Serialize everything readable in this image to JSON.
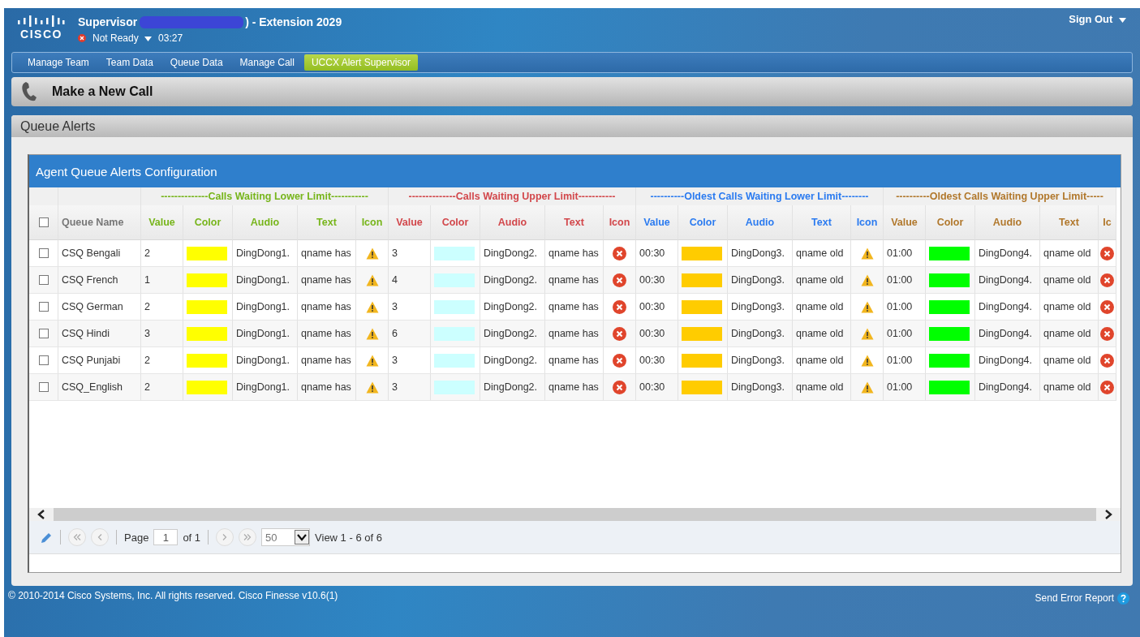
{
  "header": {
    "logo": "CISCO",
    "title_start": "Supervisor",
    "title_end": ") - Extension 2029",
    "status": "Not Ready",
    "timer": "03:27",
    "sign_out": "Sign Out"
  },
  "tabs": [
    {
      "label": "Manage Team",
      "selected": false
    },
    {
      "label": "Team Data",
      "selected": false
    },
    {
      "label": "Queue Data",
      "selected": false
    },
    {
      "label": "Manage Call",
      "selected": false
    },
    {
      "label": "UCCX Alert Supervisor",
      "selected": true
    }
  ],
  "make_call": {
    "label": "Make a New Call"
  },
  "panel": {
    "title": "Queue Alerts"
  },
  "grid": {
    "title": "Agent Queue Alerts Configuration",
    "select_all_checked": false,
    "name_header": "Queue Name",
    "groups": [
      {
        "title": "--------------Calls Waiting Lower Limit-----------",
        "color": "#77b51b",
        "columns": [
          "Value",
          "Color",
          "Audio",
          "Text",
          "Icon"
        ]
      },
      {
        "title": "--------------Calls Waiting Upper Limit-----------",
        "color": "#d2474b",
        "columns": [
          "Value",
          "Color",
          "Audio",
          "Text",
          "Icon"
        ]
      },
      {
        "title": "----------Oldest Calls Waiting Lower Limit--------",
        "color": "#2b7bf0",
        "columns": [
          "Value",
          "Color",
          "Audio",
          "Text",
          "Icon"
        ]
      },
      {
        "title": "----------Oldest Calls Waiting Upper Limit-----",
        "color": "#b1782c",
        "columns": [
          "Value",
          "Color",
          "Audio",
          "Text",
          "Ic"
        ]
      }
    ],
    "rows": [
      {
        "name": "CSQ Bengali",
        "checked": false,
        "cells": [
          {
            "value": "2",
            "color": "#ffff00",
            "audio": "DingDong1.",
            "text": "qname has",
            "kind": "warning"
          },
          {
            "value": "3",
            "color": "#ccffff",
            "audio": "DingDong2.",
            "text": "qname has",
            "kind": "error"
          },
          {
            "value": "00:30",
            "color": "#ffcc00",
            "audio": "DingDong3.",
            "text": "qname old",
            "kind": "warning"
          },
          {
            "value": "01:00",
            "color": "#00ff00",
            "audio": "DingDong4.",
            "text": "qname old",
            "kind": "error"
          }
        ]
      },
      {
        "name": "CSQ French",
        "checked": false,
        "cells": [
          {
            "value": "1",
            "color": "#ffff00",
            "audio": "DingDong1.",
            "text": "qname has",
            "kind": "warning"
          },
          {
            "value": "4",
            "color": "#ccffff",
            "audio": "DingDong2.",
            "text": "qname has",
            "kind": "error"
          },
          {
            "value": "00:30",
            "color": "#ffcc00",
            "audio": "DingDong3.",
            "text": "qname old",
            "kind": "warning"
          },
          {
            "value": "01:00",
            "color": "#00ff00",
            "audio": "DingDong4.",
            "text": "qname old",
            "kind": "error"
          }
        ]
      },
      {
        "name": "CSQ German",
        "checked": false,
        "cells": [
          {
            "value": "2",
            "color": "#ffff00",
            "audio": "DingDong1.",
            "text": "qname has",
            "kind": "warning"
          },
          {
            "value": "3",
            "color": "#ccffff",
            "audio": "DingDong2.",
            "text": "qname has",
            "kind": "error"
          },
          {
            "value": "00:30",
            "color": "#ffcc00",
            "audio": "DingDong3.",
            "text": "qname old",
            "kind": "warning"
          },
          {
            "value": "01:00",
            "color": "#00ff00",
            "audio": "DingDong4.",
            "text": "qname old",
            "kind": "error"
          }
        ]
      },
      {
        "name": "CSQ Hindi",
        "checked": false,
        "cells": [
          {
            "value": "3",
            "color": "#ffff00",
            "audio": "DingDong1.",
            "text": "qname has",
            "kind": "warning"
          },
          {
            "value": "6",
            "color": "#ccffff",
            "audio": "DingDong2.",
            "text": "qname has",
            "kind": "error"
          },
          {
            "value": "00:30",
            "color": "#ffcc00",
            "audio": "DingDong3.",
            "text": "qname old",
            "kind": "warning"
          },
          {
            "value": "01:00",
            "color": "#00ff00",
            "audio": "DingDong4.",
            "text": "qname old",
            "kind": "error"
          }
        ]
      },
      {
        "name": "CSQ Punjabi",
        "checked": false,
        "cells": [
          {
            "value": "2",
            "color": "#ffff00",
            "audio": "DingDong1.",
            "text": "qname has",
            "kind": "warning"
          },
          {
            "value": "3",
            "color": "#ccffff",
            "audio": "DingDong2.",
            "text": "qname has",
            "kind": "error"
          },
          {
            "value": "00:30",
            "color": "#ffcc00",
            "audio": "DingDong3.",
            "text": "qname old",
            "kind": "warning"
          },
          {
            "value": "01:00",
            "color": "#00ff00",
            "audio": "DingDong4.",
            "text": "qname old",
            "kind": "error"
          }
        ]
      },
      {
        "name": "CSQ_English",
        "checked": false,
        "cells": [
          {
            "value": "2",
            "color": "#ffff00",
            "audio": "DingDong1.",
            "text": "qname has",
            "kind": "warning"
          },
          {
            "value": "3",
            "color": "#ccffff",
            "audio": "DingDong2.",
            "text": "qname has",
            "kind": "error"
          },
          {
            "value": "00:30",
            "color": "#ffcc00",
            "audio": "DingDong3.",
            "text": "qname old",
            "kind": "warning"
          },
          {
            "value": "01:00",
            "color": "#00ff00",
            "audio": "DingDong4.",
            "text": "qname old",
            "kind": "error"
          }
        ]
      }
    ]
  },
  "pager": {
    "page_label": "Page",
    "page": "1",
    "of": "of 1",
    "page_size": "50",
    "view": "View 1 - 6 of 6"
  },
  "footer": {
    "copyright": "© 2010-2014 Cisco Systems, Inc. All rights reserved. Cisco Finesse v10.6(1)",
    "error_report": "Send Error Report"
  }
}
